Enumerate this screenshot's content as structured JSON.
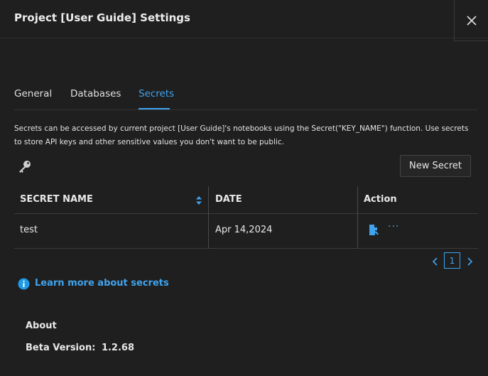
{
  "dialog": {
    "title": "Project [User Guide] Settings",
    "close_icon": "close-icon"
  },
  "tabs": [
    {
      "label": "General",
      "active": false
    },
    {
      "label": "Databases",
      "active": false
    },
    {
      "label": "Secrets",
      "active": true
    }
  ],
  "secrets": {
    "description": "Secrets can be accessed by current project [User Guide]'s notebooks using the Secret(\"KEY_NAME\") function. Use secrets to store API keys and other sensitive values you don't want to be public.",
    "key_icon": "key-icon",
    "new_button_label": "New Secret",
    "table": {
      "columns": [
        "SECRET NAME",
        "DATE",
        "Action"
      ],
      "rows": [
        {
          "name": "test",
          "date": "Apr 14,2024",
          "action_icons": [
            "edit-secret-icon",
            "more-icon"
          ],
          "more_label": "···"
        }
      ]
    },
    "pagination": {
      "current_page": "1"
    },
    "learn_more": "Learn more about secrets"
  },
  "about": {
    "title": "About",
    "version_label": "Beta Version:",
    "version_value": "1.2.68"
  },
  "colors": {
    "background": "#1f1f1f",
    "accent": "#3fa3ee",
    "text": "#e8e8e8",
    "border": "#3a3a3a"
  }
}
